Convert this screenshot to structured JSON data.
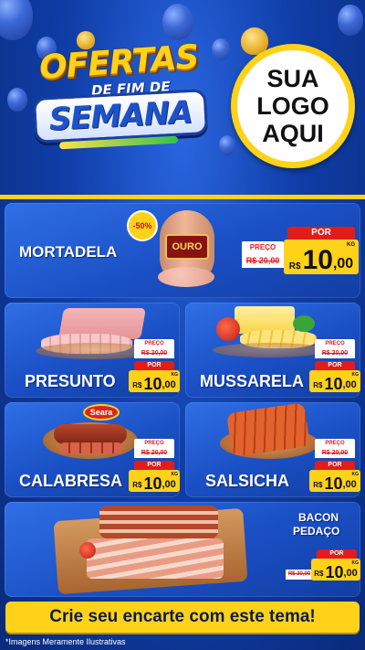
{
  "header": {
    "title_top": "OFERTAS",
    "title_middle": "DE FIM DE",
    "title_bottom": "SEMANA",
    "logo_lines": [
      "SUA",
      "LOGO",
      "AQUI"
    ]
  },
  "badge": "-50%",
  "brand_labels": {
    "mortadela_brand": "OURO",
    "calabresa_brand": "Seara"
  },
  "products": [
    {
      "name": "MORTADELA",
      "preco_label": "PREÇO",
      "old_price": "R$ 20,00",
      "por_label": "POR",
      "currency": "R$",
      "price_int": "10",
      "price_cents": ",00",
      "unit": "KG"
    },
    {
      "name": "PRESUNTO",
      "preco_label": "PREÇO",
      "old_price": "R$ 20,00",
      "por_label": "POR",
      "currency": "R$",
      "price_int": "10",
      "price_cents": ",00",
      "unit": "KG"
    },
    {
      "name": "MUSSARELA",
      "preco_label": "PREÇO",
      "old_price": "R$ 20,00",
      "por_label": "POR",
      "currency": "R$",
      "price_int": "10",
      "price_cents": ",00",
      "unit": "KG"
    },
    {
      "name": "CALABRESA",
      "preco_label": "PREÇO",
      "old_price": "R$ 20,00",
      "por_label": "POR",
      "currency": "R$",
      "price_int": "10",
      "price_cents": ",00",
      "unit": "KG"
    },
    {
      "name": "SALSICHA",
      "preco_label": "PREÇO",
      "old_price": "R$ 20,00",
      "por_label": "POR",
      "currency": "R$",
      "price_int": "10",
      "price_cents": ",00",
      "unit": "KG"
    },
    {
      "name_line1": "BACON",
      "name_line2": "PEDAÇO",
      "preco_label": "PREÇO",
      "old_price": "R$ 20,00",
      "por_label": "POR",
      "currency": "R$",
      "price_int": "10",
      "price_cents": ",00",
      "unit": "KG"
    }
  ],
  "cta": "Crie seu encarte com este tema!",
  "footnote": "*Imagens Meramente Ilustrativas",
  "colors": {
    "primary_blue": "#1a4fc4",
    "accent_yellow": "#ffd21a",
    "price_red": "#e31b1b"
  },
  "icons": [
    "balloon-icon",
    "heart-icon"
  ]
}
